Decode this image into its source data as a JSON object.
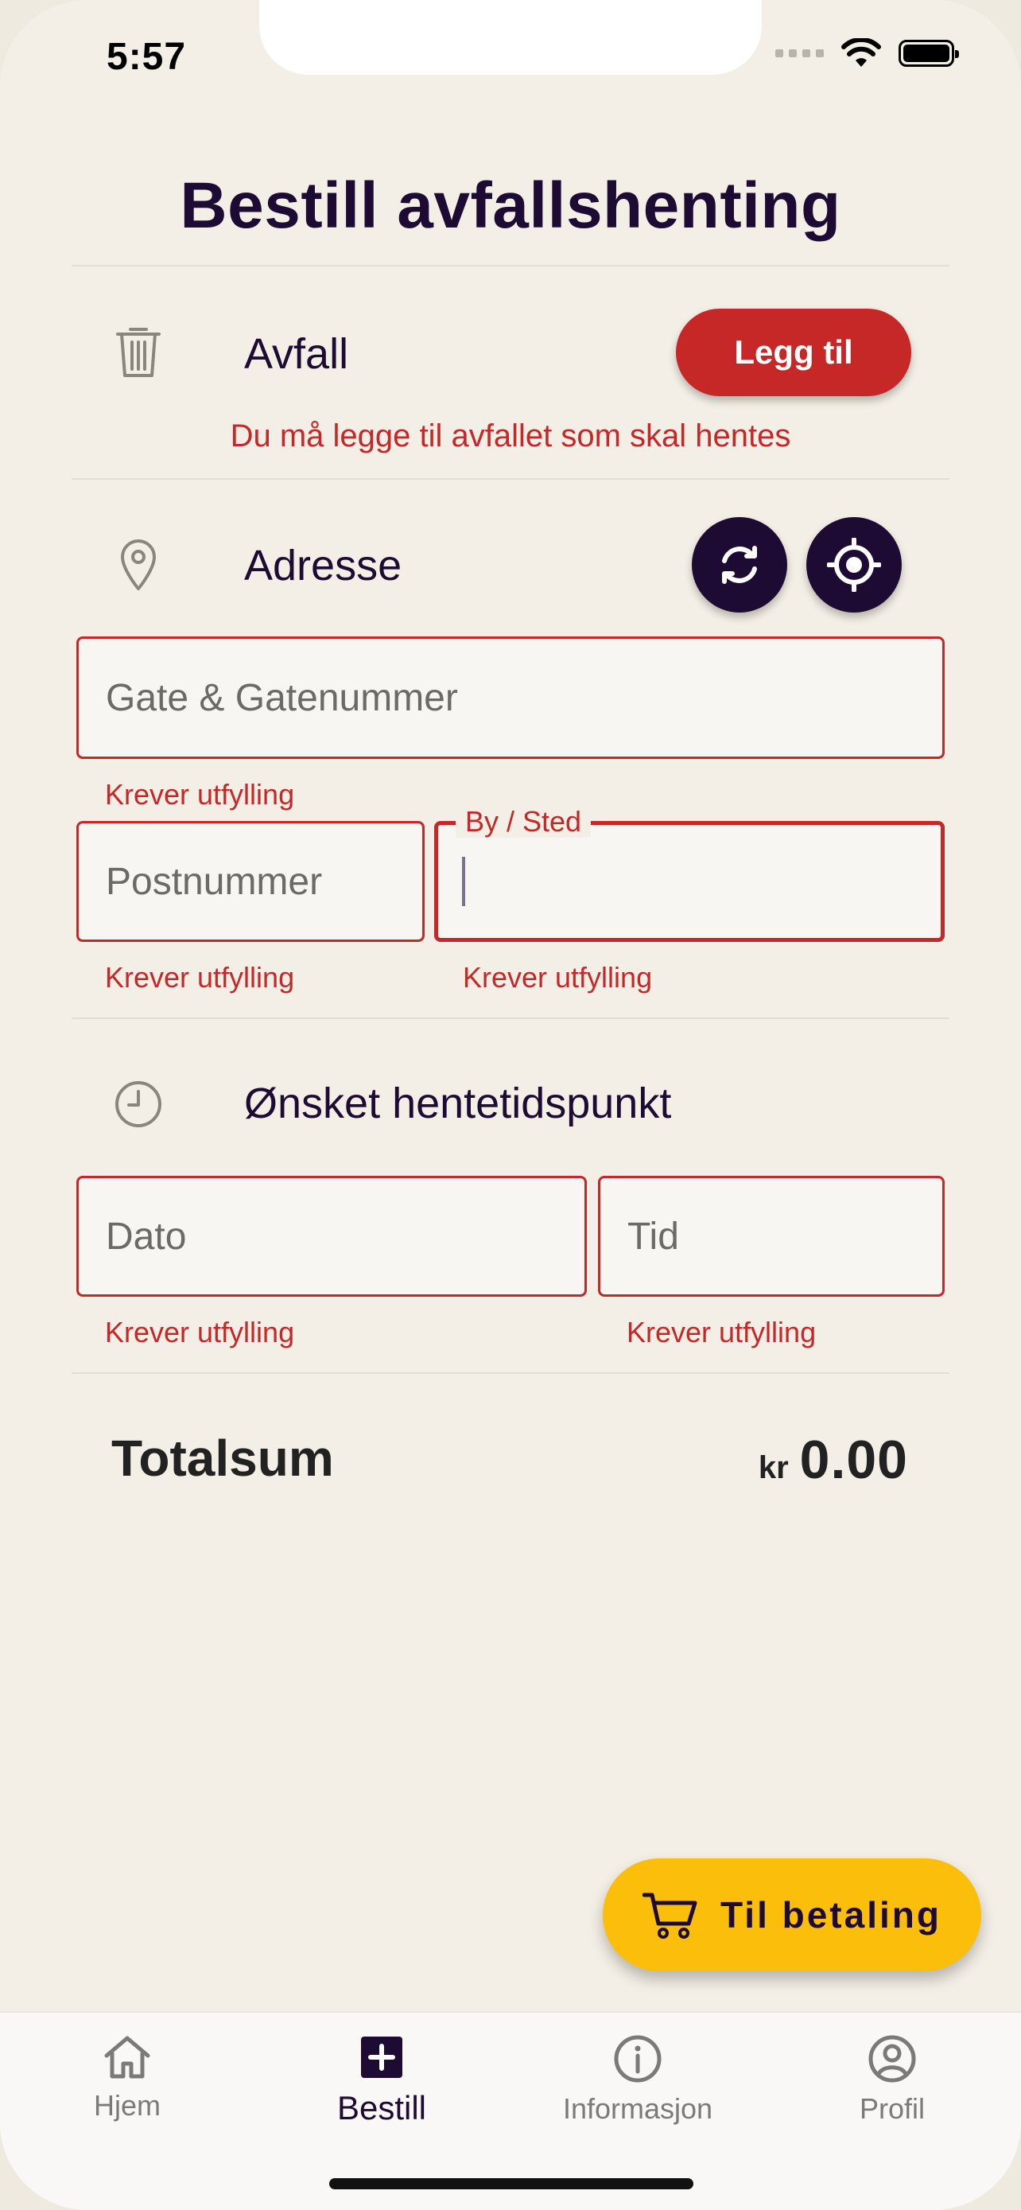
{
  "status_bar": {
    "time": "5:57"
  },
  "header": {
    "title": "Bestill avfallshenting"
  },
  "waste": {
    "label": "Avfall",
    "add_button": "Legg til",
    "error": "Du må legge til avfallet som skal hentes"
  },
  "address": {
    "label": "Adresse",
    "street": {
      "placeholder": "Gate & Gatenummer",
      "value": "",
      "error": "Krever utfylling"
    },
    "postcode": {
      "placeholder": "Postnummer",
      "value": "",
      "error": "Krever utfylling"
    },
    "city": {
      "label": "By / Sted",
      "value": "",
      "error": "Krever utfylling"
    }
  },
  "pickup_time": {
    "label": "Ønsket hentetidspunkt",
    "date": {
      "placeholder": "Dato",
      "value": "",
      "error": "Krever utfylling"
    },
    "time": {
      "placeholder": "Tid",
      "value": "",
      "error": "Krever utfylling"
    }
  },
  "total": {
    "label": "Totalsum",
    "currency": "kr",
    "amount": "0.00"
  },
  "checkout_button": "Til betaling",
  "nav": [
    {
      "label": "Hjem",
      "icon": "home-icon",
      "active": false
    },
    {
      "label": "Bestill",
      "icon": "plus-square-icon",
      "active": true
    },
    {
      "label": "Informasjon",
      "icon": "info-icon",
      "active": false
    },
    {
      "label": "Profil",
      "icon": "profile-icon",
      "active": false
    }
  ],
  "colors": {
    "primary": "#1e0b33",
    "error": "#c62828",
    "accent": "#fbbe0a",
    "background": "#f3efe6"
  }
}
